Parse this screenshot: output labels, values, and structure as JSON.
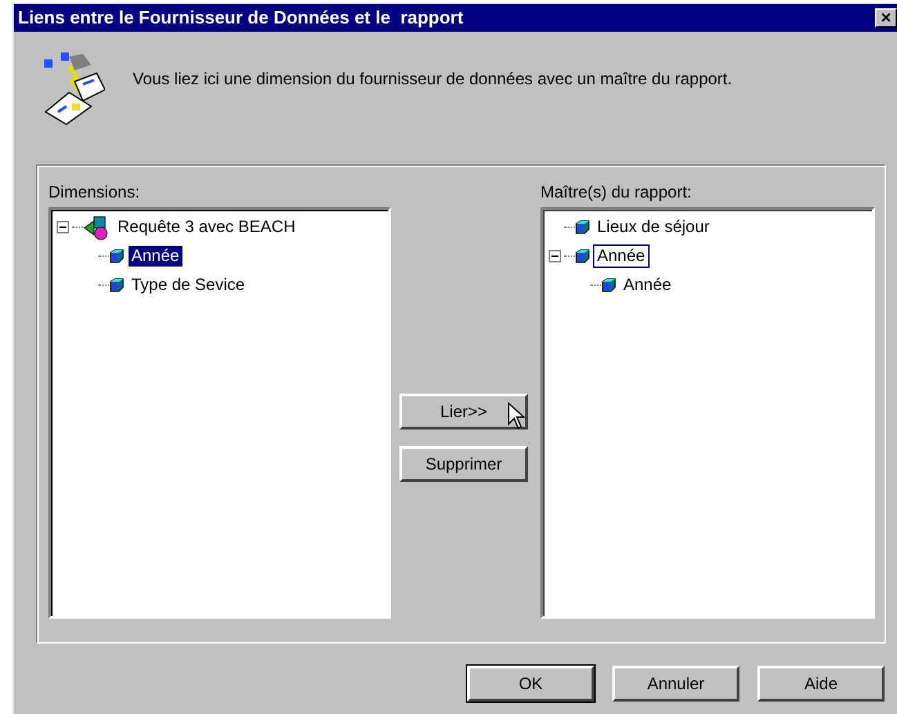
{
  "window": {
    "title": "Liens entre le Fournisseur de Données et le  rapport",
    "close": "×"
  },
  "intro": "Vous liez ici une dimension du fournisseur de données avec un maître du rapport.",
  "dimensions": {
    "label": "Dimensions:",
    "focused": true,
    "items": [
      {
        "label": "Requête 3 avec BEACH",
        "kind": "query",
        "expanded": true,
        "selected": false,
        "children": [
          {
            "label": "Année",
            "kind": "dimension",
            "selected": true
          },
          {
            "label": "Type de Sevice",
            "kind": "dimension",
            "selected": false
          }
        ]
      }
    ]
  },
  "masters": {
    "label": "Maître(s) du rapport:",
    "focused": false,
    "items": [
      {
        "label": "Lieux de séjour",
        "kind": "dimension",
        "selected": false
      },
      {
        "label": "Année",
        "kind": "dimension",
        "expanded": true,
        "selected": true,
        "children": [
          {
            "label": "Année",
            "kind": "dimension",
            "selected": false
          }
        ]
      }
    ]
  },
  "middle_buttons": [
    "Lier>>",
    "Supprimer"
  ],
  "buttons": [
    {
      "label": "OK",
      "default": true
    },
    {
      "label": "Annuler",
      "default": false
    },
    {
      "label": "Aide",
      "default": false
    }
  ]
}
